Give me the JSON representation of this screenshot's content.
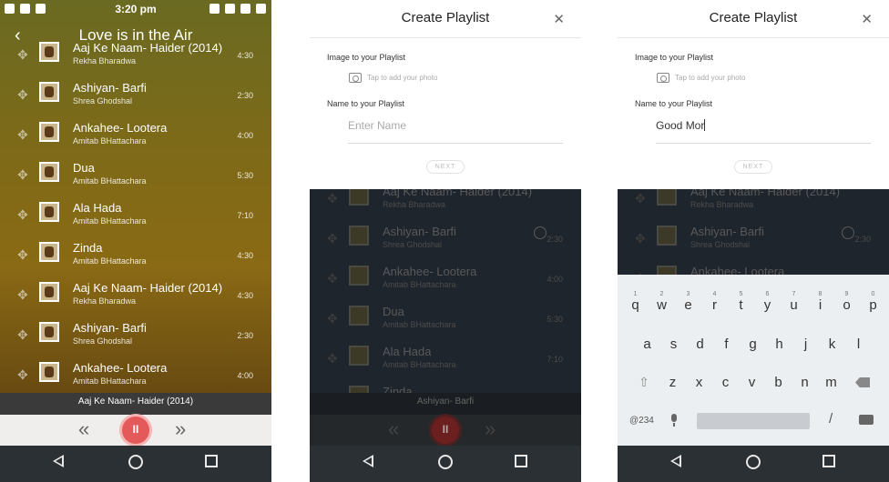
{
  "screen1": {
    "status": {
      "time": "3:20 pm"
    },
    "header": {
      "back_icon": "‹",
      "title": "Love is in the Air"
    },
    "songs": [
      {
        "name": "Aaj Ke Naam- Haider (2014)",
        "artist": "Rekha Bharadwa",
        "duration": "4:30"
      },
      {
        "name": "Ashiyan- Barfi",
        "artist": "Shrea Ghodshal",
        "duration": "2:30"
      },
      {
        "name": "Ankahee- Lootera",
        "artist": "Amitab BHattachara",
        "duration": "4:00"
      },
      {
        "name": "Dua",
        "artist": "Amitab BHattachara",
        "duration": "5:30"
      },
      {
        "name": "Ala Hada",
        "artist": "Amitab BHattachara",
        "duration": "7:10"
      },
      {
        "name": "Zinda",
        "artist": "Amitab BHattachara",
        "duration": "4:30"
      },
      {
        "name": "Aaj Ke Naam- Haider (2014)",
        "artist": "Rekha Bharadwa",
        "duration": "4:30"
      },
      {
        "name": "Ashiyan- Barfi",
        "artist": "Shrea Ghodshal",
        "duration": "2:30"
      },
      {
        "name": "Ankahee- Lootera",
        "artist": "Amitab BHattachara",
        "duration": "4:00"
      }
    ],
    "now_playing": "Aaj Ke Naam- Haider (2014)"
  },
  "dialog": {
    "title": "Create Playlist",
    "close_icon": "✕",
    "image_label": "Image to your Playlist",
    "photo_hint": "Tap to add your photo",
    "name_label": "Name to your Playlist",
    "next_label": "NEXT"
  },
  "screen2": {
    "name_placeholder": "Enter Name",
    "background_songs": [
      {
        "name": "Aaj Ke Naam- Haider (2014)",
        "artist": "Rekha Bharadwa",
        "duration": ""
      },
      {
        "name": "Ashiyan- Barfi",
        "artist": "Shrea Ghodshal",
        "duration": "2:30"
      },
      {
        "name": "Ankahee- Lootera",
        "artist": "Amitab BHattachara",
        "duration": "4:00"
      },
      {
        "name": "Dua",
        "artist": "Amitab BHattachara",
        "duration": "5:30"
      },
      {
        "name": "Ala Hada",
        "artist": "Amitab BHattachara",
        "duration": "7:10"
      },
      {
        "name": "Zinda",
        "artist": "",
        "duration": ""
      }
    ],
    "now_playing": "Ashiyan- Barfi"
  },
  "screen3": {
    "name_value": "Good Mor",
    "background_songs": [
      {
        "name": "Aaj Ke Naam- Haider (2014)",
        "artist": "Rekha Bharadwa",
        "duration": ""
      },
      {
        "name": "Ashiyan- Barfi",
        "artist": "Shrea Ghodshal",
        "duration": "2:30"
      },
      {
        "name": "Ankahee- Lootera",
        "artist": "",
        "duration": ""
      }
    ],
    "keyboard": {
      "row1": [
        "q",
        "w",
        "e",
        "r",
        "t",
        "y",
        "u",
        "i",
        "o",
        "p"
      ],
      "row1_nums": [
        "1",
        "2",
        "3",
        "4",
        "5",
        "6",
        "7",
        "8",
        "9",
        "0"
      ],
      "row2": [
        "a",
        "s",
        "d",
        "f",
        "g",
        "h",
        "j",
        "k",
        "l"
      ],
      "row3": [
        "z",
        "x",
        "c",
        "v",
        "b",
        "n",
        "m"
      ],
      "symbols_label": "@234",
      "slash": "/"
    }
  },
  "controls": {
    "prev_icon": "«",
    "play_icon": "II",
    "next_icon": "»"
  },
  "accent_color": "#e45a5a"
}
